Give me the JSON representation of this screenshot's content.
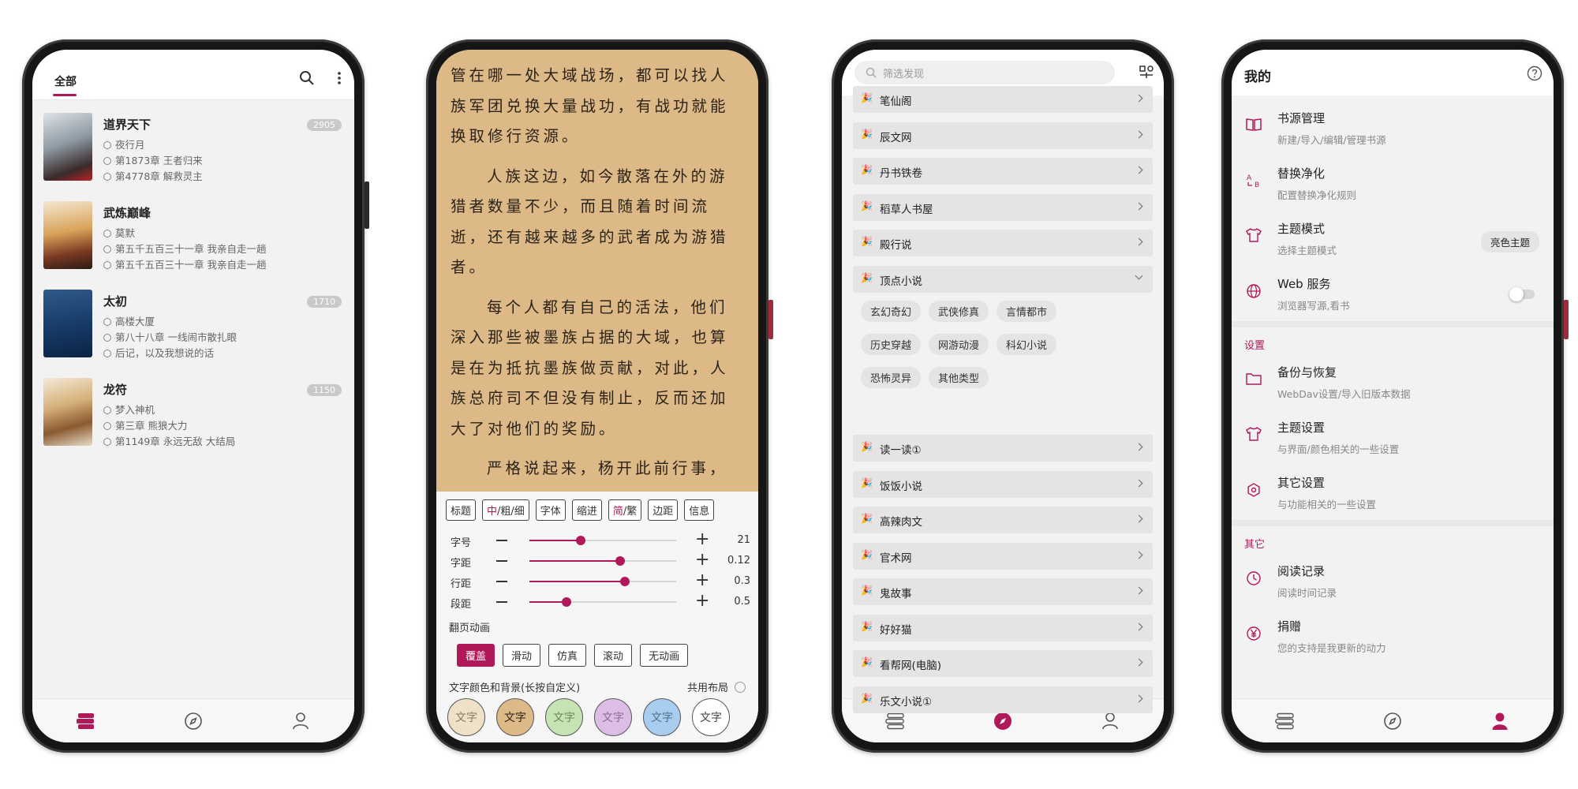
{
  "colors": {
    "accent": "#b0185a",
    "reader_bg": "#dcb987"
  },
  "bookshelf": {
    "tab": "全部",
    "books": [
      {
        "title": "道界天下",
        "author": "夜行月",
        "last_read": "第1873章 王者归来",
        "latest": "第4778章 解救灵主",
        "count": "2905"
      },
      {
        "title": "武炼巅峰",
        "author": "莫默",
        "last_read": "第五千五百三十一章 我亲自走一趟",
        "latest": "第五千五百三十一章 我亲自走一趟",
        "count": ""
      },
      {
        "title": "太初",
        "author": "高楼大厦",
        "last_read": "第八十八章 一线闹市散扎眼",
        "latest": "后记，以及我想说的话",
        "count": "1710"
      },
      {
        "title": "龙符",
        "author": "梦入神机",
        "last_read": "第三章 熊狼大力",
        "latest": "第1149章 永远无敌 大结局",
        "count": "1150"
      }
    ]
  },
  "reader": {
    "paragraphs": [
      "管在哪一处大域战场，都可以找人族军团兑换大量战功，有战功就能换取修行资源。",
      "人族这边，如今散落在外的游猎者数量不少，而且随着时间流逝，还有越来越多的武者成为游猎者。",
      "每个人都有自己的活法，他们深入那些被墨族占据的大域，也算是在为抵抗墨族做贡献，对此，人族总府司不但没有制止，反而还加大了对他们的奖励。",
      "严格说起来，杨开此前行事，"
    ],
    "toolbar": {
      "title": "标题",
      "weight_prefix": "中",
      "weight_rest": "/粗/细",
      "font": "字体",
      "indent": "缩进",
      "conv_prefix": "简",
      "conv_rest": "/繁",
      "margin": "边距",
      "info": "信息"
    },
    "sliders": [
      {
        "label": "字号",
        "value": "21",
        "fraction": 0.35
      },
      {
        "label": "字距",
        "value": "0.12",
        "fraction": 0.62
      },
      {
        "label": "行距",
        "value": "0.3",
        "fraction": 0.65
      },
      {
        "label": "段距",
        "value": "0.5",
        "fraction": 0.25
      }
    ],
    "page_anim_label": "翻页动画",
    "animations": [
      "覆盖",
      "滑动",
      "仿真",
      "滚动",
      "无动画"
    ],
    "active_animation": 0,
    "color_label": "文字颜色和背景(长按自定义)",
    "shared_layout": "共用布局",
    "swatches": [
      {
        "text": "文字",
        "bg": "#efe1c8",
        "fg": "#8a7a60"
      },
      {
        "text": "文字",
        "bg": "#dcb987",
        "fg": "#2b2318"
      },
      {
        "text": "文字",
        "bg": "#c6e3b4",
        "fg": "#6a8a5a"
      },
      {
        "text": "文字",
        "bg": "#dcbde6",
        "fg": "#8a6a96"
      },
      {
        "text": "文字",
        "bg": "#a8cdef",
        "fg": "#50708e"
      },
      {
        "text": "文字",
        "bg": "#ffffff",
        "fg": "#444444"
      }
    ]
  },
  "discover": {
    "search_placeholder": "筛选发现",
    "sources_top": [
      "笔仙阁",
      "辰文网",
      "丹书铁卷",
      "稻草人书屋",
      "殿行说",
      "顶点小说"
    ],
    "tags": [
      "玄幻奇幻",
      "武侠修真",
      "言情都市",
      "历史穿越",
      "网游动漫",
      "科幻小说",
      "恐怖灵异",
      "其他类型"
    ],
    "sources_bottom": [
      "读一读①",
      "饭饭小说",
      "高辣肉文",
      "官术网",
      "鬼故事",
      "好好猫",
      "看帮网(电脑)",
      "乐文小说①"
    ]
  },
  "mine": {
    "title": "我的",
    "items_top": [
      {
        "title": "书源管理",
        "sub": "新建/导入/编辑/管理书源",
        "icon": "book-icon"
      },
      {
        "title": "替换净化",
        "sub": "配置替换净化规则",
        "icon": "replace-icon"
      },
      {
        "title": "主题模式",
        "sub": "选择主题模式",
        "icon": "shirt-icon",
        "pill": "亮色主题"
      },
      {
        "title": "Web 服务",
        "sub": "浏览器写源,看书",
        "icon": "globe-icon"
      }
    ],
    "settings_label": "设置",
    "items_settings": [
      {
        "title": "备份与恢复",
        "sub": "WebDav设置/导入旧版本数据",
        "icon": "folder-icon"
      },
      {
        "title": "主题设置",
        "sub": "与界面/颜色相关的一些设置",
        "icon": "shirt-icon"
      },
      {
        "title": "其它设置",
        "sub": "与功能相关的一些设置",
        "icon": "settings-icon"
      }
    ],
    "other_label": "其它",
    "items_other": [
      {
        "title": "阅读记录",
        "sub": "阅读时间记录",
        "icon": "clock-icon"
      },
      {
        "title": "捐赠",
        "sub": "您的支持是我更新的动力",
        "icon": "yen-icon"
      }
    ]
  }
}
